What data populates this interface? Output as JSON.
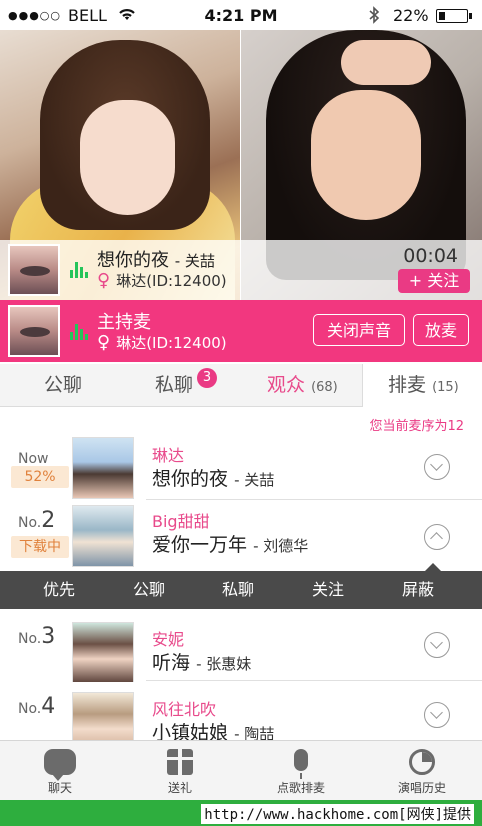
{
  "status_bar": {
    "signal": "●●●○○",
    "carrier": "BELL",
    "wifi_icon": "wifi-icon",
    "time": "4:21 PM",
    "bluetooth_icon": "bluetooth-icon",
    "battery": "22%",
    "battery_level": 0.22
  },
  "now_playing": {
    "song": "想你的夜",
    "artist": "- 关喆",
    "user": "琳达(ID:12400)",
    "timer": "00:04",
    "follow_label": "+ 关注"
  },
  "host": {
    "title": "主持麦",
    "user": "琳达(ID:12400)",
    "mute_label": "关闭声音",
    "release_label": "放麦"
  },
  "tabs": [
    {
      "label": "公聊",
      "count": ""
    },
    {
      "label": "私聊",
      "count": ""
    },
    {
      "label": "观众",
      "count": "(68)"
    },
    {
      "label": "排麦",
      "count": "(15)"
    }
  ],
  "private_badge": "3",
  "queue_note": "您当前麦序为12",
  "queue": [
    {
      "rank_prefix": "Now",
      "rank_num": "",
      "tag": "52%",
      "singer": "琳达",
      "song": "想你的夜",
      "artist": "- 关喆",
      "progress": 0.52
    },
    {
      "rank_prefix": "No.",
      "rank_num": "2",
      "tag": "下载中",
      "singer": "Big甜甜",
      "song": "爱你一万年",
      "artist": "- 刘德华"
    },
    {
      "rank_prefix": "No.",
      "rank_num": "3",
      "tag": "",
      "singer": "安妮",
      "song": "听海",
      "artist": "- 张惠妹"
    },
    {
      "rank_prefix": "No.",
      "rank_num": "4",
      "tag": "",
      "singer": "风往北吹",
      "song": "小镇姑娘",
      "artist": "- 陶喆"
    }
  ],
  "actions": [
    "优先",
    "公聊",
    "私聊",
    "关注",
    "屏蔽"
  ],
  "bottom_nav": [
    {
      "label": "聊天",
      "icon": "chat-icon"
    },
    {
      "label": "送礼",
      "icon": "gift-icon"
    },
    {
      "label": "点歌排麦",
      "icon": "mic-icon"
    },
    {
      "label": "演唱历史",
      "icon": "history-icon"
    }
  ],
  "watermark": "http://www.hackhome.com[网侠]提供",
  "colors": {
    "accent": "#f2377f",
    "footer": "#2eae3e"
  }
}
